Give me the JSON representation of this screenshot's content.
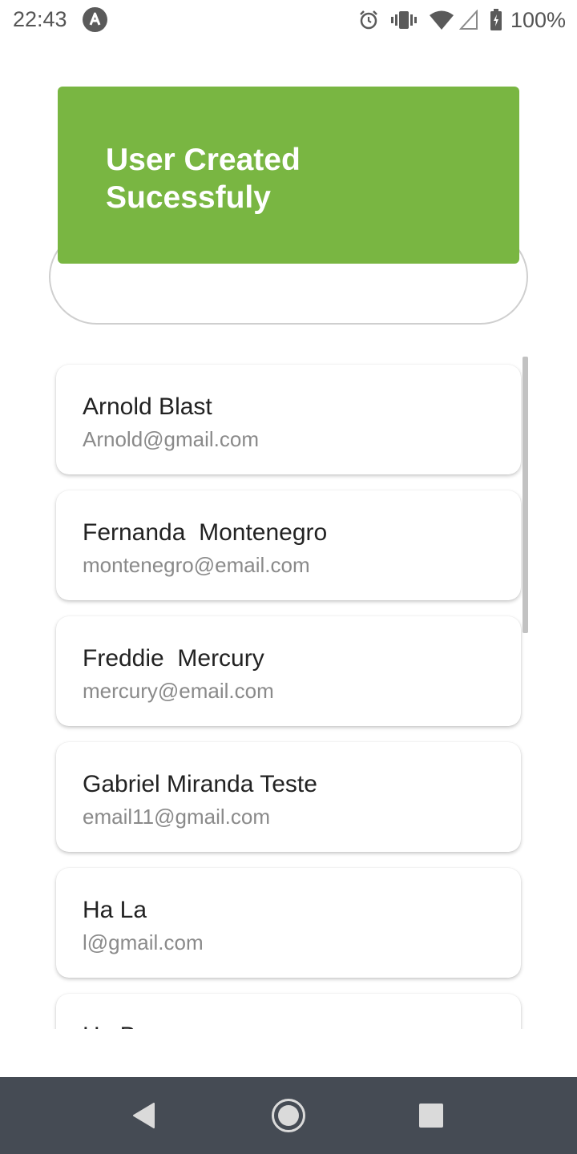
{
  "status_bar": {
    "time": "22:43",
    "battery_text": "100%",
    "icons": [
      "app-notification-icon",
      "alarm-icon",
      "vibrate-icon",
      "wifi-icon",
      "cell-signal-icon",
      "battery-charging-icon"
    ]
  },
  "toast": {
    "message": "User Created Sucessfuly",
    "color": "#79b642"
  },
  "search": {
    "placeholder": ""
  },
  "users": [
    {
      "name": "Arnold Blast",
      "email": "Arnold@gmail.com"
    },
    {
      "name": "Fernanda  Montenegro",
      "email": "montenegro@email.com"
    },
    {
      "name": "Freddie  Mercury",
      "email": "mercury@email.com"
    },
    {
      "name": "Gabriel Miranda Teste",
      "email": "email11@gmail.com"
    },
    {
      "name": "Ha La",
      "email": "l@gmail.com"
    },
    {
      "name": "Hu Ba",
      "email": ""
    }
  ],
  "nav_bar": {
    "icons": [
      "back-icon",
      "home-icon",
      "recents-icon"
    ],
    "color": "#454b54"
  }
}
